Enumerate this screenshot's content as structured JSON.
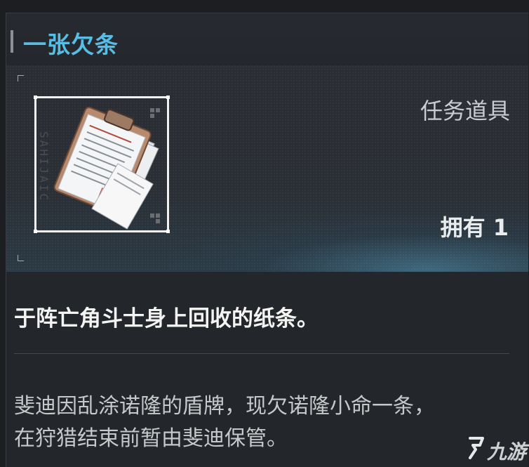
{
  "item": {
    "title": "一张欠条",
    "category": "任务道具",
    "owned": "拥有 1",
    "serial_code": "SAHIJAIC",
    "description": "于阵亡角斗士身上回收的纸条。",
    "lore_lines": [
      "斐迪因乱涂诺隆的盾牌，现欠诺隆小命一条，",
      "在狩猎结束前暂由斐迪保管。"
    ]
  },
  "watermark": {
    "text": "九游",
    "icon": "jiuyou-logo-icon"
  },
  "colors": {
    "title": "#58bde5",
    "accent_stripe": "#6cc8e6",
    "panel_bg": "#23262b"
  }
}
